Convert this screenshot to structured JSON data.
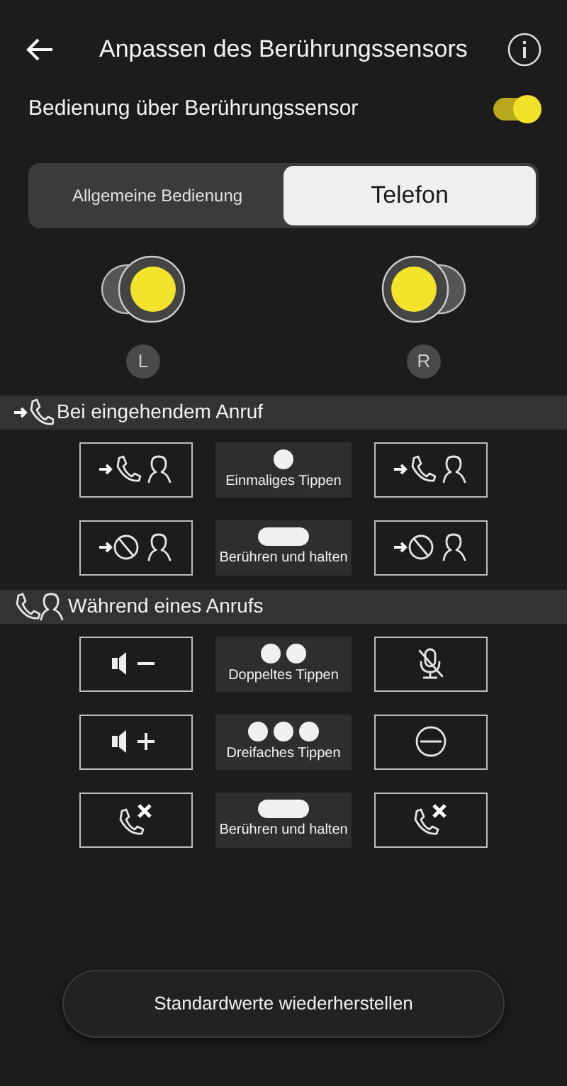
{
  "header": {
    "title": "Anpassen des Berührungssensors"
  },
  "sensor_control": {
    "label": "Bedienung über Berührungssensor",
    "on": true
  },
  "tabs": [
    {
      "label": "Allgemeine Bedienung",
      "selected": false
    },
    {
      "label": "Telefon",
      "selected": true
    }
  ],
  "earbuds": [
    {
      "kind": "left",
      "label": "L"
    },
    {
      "kind": "right",
      "label": "R"
    }
  ],
  "sections": [
    {
      "title": "Bei eingehendem Anruf",
      "kind": "incoming",
      "rows": [
        {
          "left": {
            "kind": "answer"
          },
          "gesture": {
            "kind": "single",
            "label": "Einmaliges Tippen"
          },
          "right": {
            "kind": "answer"
          }
        },
        {
          "left": {
            "kind": "reject"
          },
          "gesture": {
            "kind": "hold",
            "label": "Berühren und halten"
          },
          "right": {
            "kind": "reject"
          }
        }
      ]
    },
    {
      "title": "Während eines Anrufs",
      "kind": "call",
      "rows": [
        {
          "left": {
            "kind": "voldown"
          },
          "gesture": {
            "kind": "double",
            "label": "Doppeltes Tippen"
          },
          "right": {
            "kind": "mute"
          }
        },
        {
          "left": {
            "kind": "volup"
          },
          "gesture": {
            "kind": "triple",
            "label": "Dreifaches Tippen"
          },
          "right": {
            "kind": "minus"
          }
        },
        {
          "left": {
            "kind": "hangup"
          },
          "gesture": {
            "kind": "hold",
            "label": "Berühren und halten"
          },
          "right": {
            "kind": "hangup"
          }
        }
      ]
    }
  ],
  "reset_button": {
    "label": "Standardwerte wiederherstellen"
  }
}
